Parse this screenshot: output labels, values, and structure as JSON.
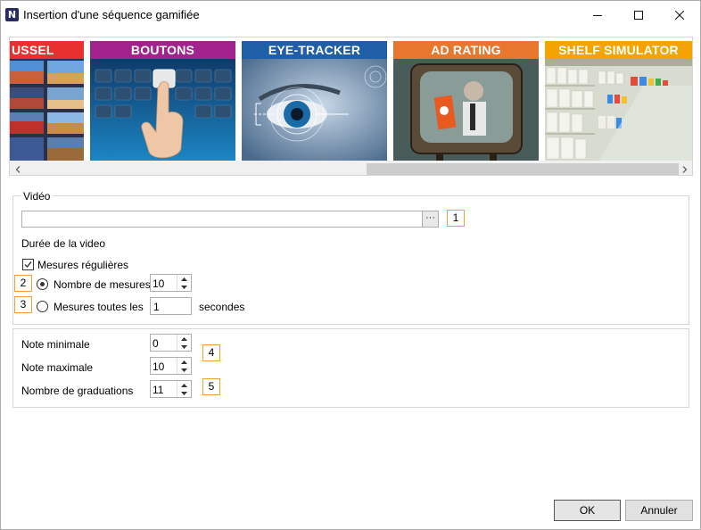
{
  "window": {
    "title": "Insertion d'une séquence gamifiée",
    "app_icon_letter": "N"
  },
  "carousel": {
    "items": [
      {
        "label": "USSEL",
        "header_color": "#e8312f"
      },
      {
        "label": "BOUTONS",
        "header_color": "#a3238e"
      },
      {
        "label": "EYE-TRACKER",
        "header_color": "#1f5fa8"
      },
      {
        "label": "AD RATING",
        "header_color": "#e8762c"
      },
      {
        "label": "SHELF SIMULATOR",
        "header_color": "#f5a300"
      }
    ]
  },
  "video": {
    "legend": "Vidéo",
    "path_value": "",
    "browse_label": "···",
    "duration_label": "Durée de la video",
    "regular_measures_label": "Mesures régulières",
    "regular_measures_checked": true,
    "count_label": "Nombre de mesures",
    "count_value": "10",
    "interval_label": "Mesures toutes les",
    "interval_value": "1",
    "interval_unit": "secondes"
  },
  "rating": {
    "min_label": "Note minimale",
    "min_value": "0",
    "max_label": "Note maximale",
    "max_value": "10",
    "steps_label": "Nombre de graduations",
    "steps_value": "11"
  },
  "callouts": [
    "1",
    "2",
    "3",
    "4",
    "5"
  ],
  "footer": {
    "ok_label": "OK",
    "cancel_label": "Annuler"
  },
  "colors": {
    "callout_border": "#f0a030"
  }
}
